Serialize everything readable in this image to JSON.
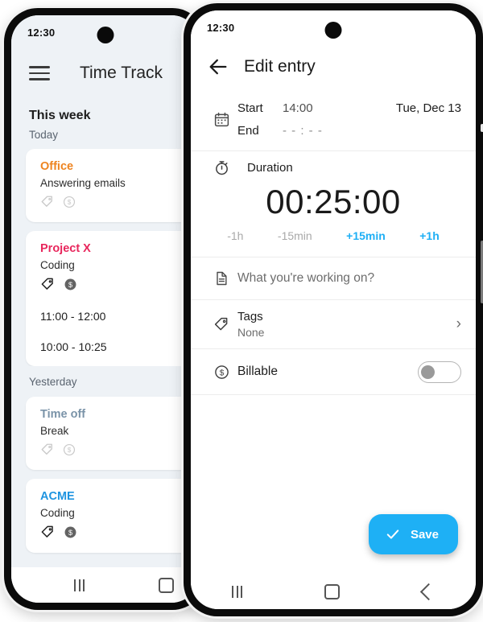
{
  "left_phone": {
    "status": {
      "time": "12:30"
    },
    "appbar": {
      "menu_icon": "hamburger-menu-icon",
      "title": "Time Track"
    },
    "sections": [
      {
        "week_label": "This week",
        "day_label": "Today"
      },
      {
        "day_label": "Yesterday"
      }
    ],
    "entries": [
      {
        "project": "Office",
        "project_color": "#EE8420",
        "description": "Answering emails",
        "tag_active": false,
        "billable_active": false,
        "times": []
      },
      {
        "project": "Project X",
        "project_color": "#E8265C",
        "description": "Coding",
        "tag_active": true,
        "billable_active": true,
        "times": [
          "11:00 - 12:00",
          "10:00 - 10:25"
        ]
      },
      {
        "project": "Time off",
        "project_color": "#7A93A8",
        "description": "Break",
        "tag_active": false,
        "billable_active": false,
        "times": []
      },
      {
        "project": "ACME",
        "project_color": "#1E94E0",
        "description": "Coding",
        "tag_active": true,
        "billable_active": true,
        "times": []
      }
    ],
    "navbar": {
      "recents": "recents-icon",
      "home": "home-icon"
    }
  },
  "right_phone": {
    "status": {
      "time": "12:30"
    },
    "appbar": {
      "back_icon": "back-arrow-icon",
      "title": "Edit entry"
    },
    "datetime": {
      "icon": "calendar-icon",
      "start_label": "Start",
      "start_value": "14:00",
      "end_label": "End",
      "end_value": "- - : - -",
      "date": "Tue, Dec 13"
    },
    "duration": {
      "icon": "stopwatch-icon",
      "title": "Duration",
      "value": "00:25:00",
      "steps": [
        {
          "label": "-1h",
          "state": "dim"
        },
        {
          "label": "-15min",
          "state": "dim"
        },
        {
          "label": "+15min",
          "state": "on"
        },
        {
          "label": "+1h",
          "state": "on"
        }
      ],
      "accent_color": "#1EAFF5"
    },
    "note": {
      "icon": "note-icon",
      "placeholder": "What you're working on?"
    },
    "tags": {
      "icon": "tag-icon",
      "title": "Tags",
      "value": "None",
      "chevron": "chevron-right-icon"
    },
    "billable": {
      "icon": "dollar-coin-icon",
      "title": "Billable",
      "toggle_on": false
    },
    "save": {
      "icon": "check-icon",
      "label": "Save",
      "color": "#1EB0F5"
    },
    "navbar": {
      "recents": "recents-icon",
      "home": "home-icon",
      "back": "back-icon"
    }
  }
}
